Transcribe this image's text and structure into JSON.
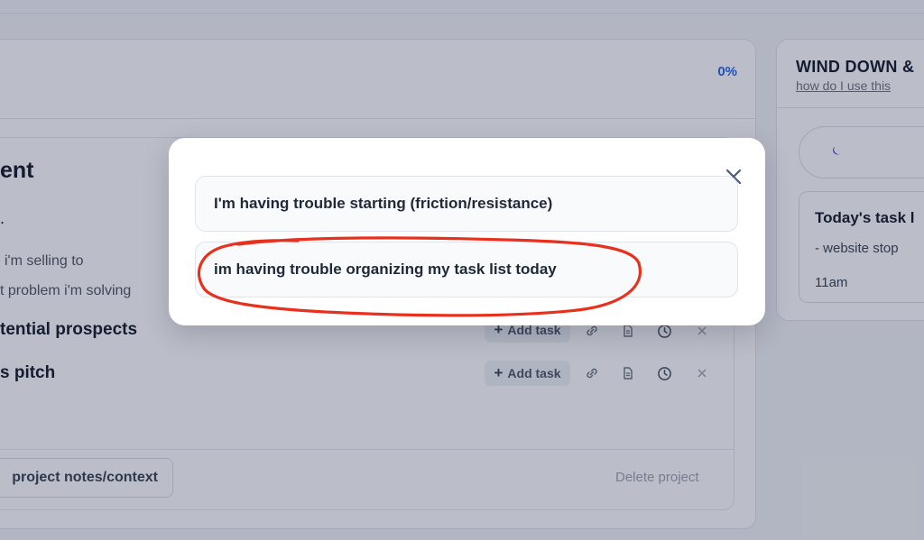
{
  "project": {
    "progress_label": "0%",
    "title_fragment": "ent",
    "stray_fragment": ".",
    "notes": [
      "i'm selling to",
      "t problem i'm solving"
    ],
    "tasks": [
      {
        "title": "tential prospects",
        "add_label": "Add task"
      },
      {
        "title": "s pitch",
        "add_label": "Add task"
      }
    ],
    "notes_button_label": "project notes/context",
    "delete_label": "Delete project"
  },
  "sidebar": {
    "title": "WIND DOWN &",
    "help_link": "how do I use this",
    "today_title": "Today's task l",
    "today_item": "- website stop",
    "today_time": "11am"
  },
  "modal": {
    "options": [
      "I'm having trouble starting (friction/resistance)",
      "im having trouble organizing my task list today"
    ],
    "annotation_color": "#e8311c"
  },
  "colors": {
    "accent": "#2563eb",
    "overlay": "rgba(30,41,72,0.30)",
    "moon": "#4f46e5"
  }
}
